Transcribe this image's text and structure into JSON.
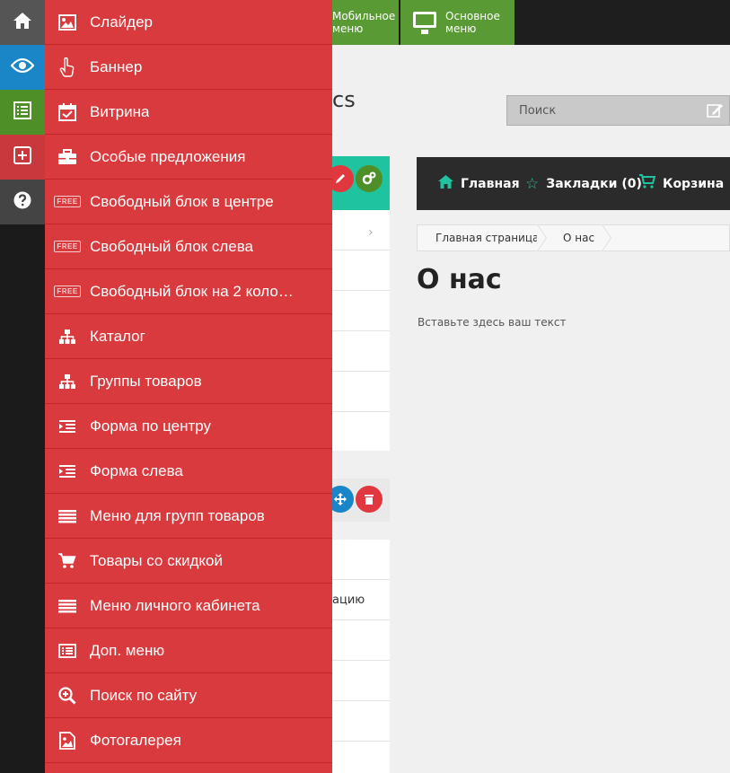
{
  "topbar": {
    "mobile_menu_label": "Мобильное меню",
    "main_menu_label": "Основное меню"
  },
  "header": {
    "brand_fragment": "cs",
    "search_placeholder": "Поиск"
  },
  "navbar": {
    "home": "Главная",
    "bookmarks": "Закладки (0)",
    "cart": "Корзина"
  },
  "breadcrumb": {
    "items": [
      "Главная страница",
      "О нас"
    ]
  },
  "page": {
    "title": "О нас",
    "text": "Вставьте здесь ваш текст"
  },
  "left_fragment": {
    "text": "ацию"
  },
  "rail": {
    "items": [
      {
        "icon": "home-icon",
        "color": "#555555"
      },
      {
        "icon": "eye-icon",
        "color": "#1a86c7"
      },
      {
        "icon": "list-icon",
        "color": "#4f8f27"
      },
      {
        "icon": "add-icon",
        "color": "#c9383c"
      },
      {
        "icon": "help-icon",
        "color": "#444444"
      }
    ]
  },
  "menu": {
    "background": "#d83a3e",
    "items": [
      {
        "label": "Слайдер",
        "icon": "image-icon"
      },
      {
        "label": "Баннер",
        "icon": "pointer-icon"
      },
      {
        "label": "Витрина",
        "icon": "calendar-check-icon"
      },
      {
        "label": "Особые предложения",
        "icon": "briefcase-icon"
      },
      {
        "label": "Свободный блок в центре",
        "icon": "free-icon"
      },
      {
        "label": "Свободный блок слева",
        "icon": "free-icon"
      },
      {
        "label": "Свободный блок на 2 коло…",
        "icon": "free-icon"
      },
      {
        "label": "Каталог",
        "icon": "sitemap-icon"
      },
      {
        "label": "Группы товаров",
        "icon": "sitemap-icon"
      },
      {
        "label": "Форма по центру",
        "icon": "form-icon"
      },
      {
        "label": "Форма слева",
        "icon": "form-icon"
      },
      {
        "label": "Меню для групп товаров",
        "icon": "menu-lines-icon"
      },
      {
        "label": "Товары со скидкой",
        "icon": "cart-icon"
      },
      {
        "label": "Меню личного кабинета",
        "icon": "menu-lines-icon"
      },
      {
        "label": "Доп. меню",
        "icon": "list-alt-icon"
      },
      {
        "label": "Поиск по сайту",
        "icon": "zoom-icon"
      },
      {
        "label": "Фотогалерея",
        "icon": "photo-icon"
      }
    ]
  }
}
